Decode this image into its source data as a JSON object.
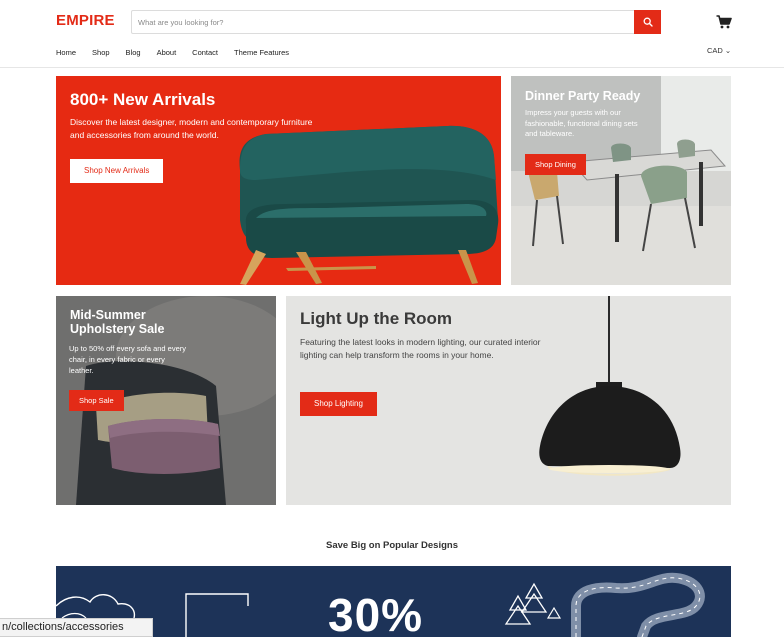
{
  "store": {
    "logo": "EMPIRE",
    "colors": {
      "accent": "#e32b17",
      "promo_bg": "#1d3358"
    }
  },
  "search": {
    "placeholder": "What are you looking for?",
    "value": "",
    "button_icon": "search-icon"
  },
  "header": {
    "cart_icon": "cart-icon",
    "currency": "CAD ⌄"
  },
  "nav": {
    "items": [
      "Home",
      "Shop",
      "Blog",
      "About",
      "Contact",
      "Theme Features"
    ]
  },
  "tiles": [
    {
      "title": "800+ New Arrivals",
      "text": "Discover the latest designer, modern and contemporary furniture and accessories from around the world.",
      "button": "Shop New Arrivals"
    },
    {
      "title": "Dinner Party Ready",
      "text": "Impress your guests with our fashionable, functional dining sets and tableware.",
      "button": "Shop Dining"
    },
    {
      "title": "Mid-Summer Upholstery Sale",
      "text": "Up to 50% off every sofa and every chair, in every fabric or every leather.",
      "button": "Shop Sale"
    },
    {
      "title": "Light Up the Room",
      "text": "Featuring the latest looks in modern lighting, our curated interior lighting can help transform the rooms in your home.",
      "button": "Shop Lighting"
    }
  ],
  "section": {
    "title": "Save Big on Popular Designs"
  },
  "promo": {
    "headline": "30%"
  },
  "status_bar": {
    "url": "n/collections/accessories"
  }
}
